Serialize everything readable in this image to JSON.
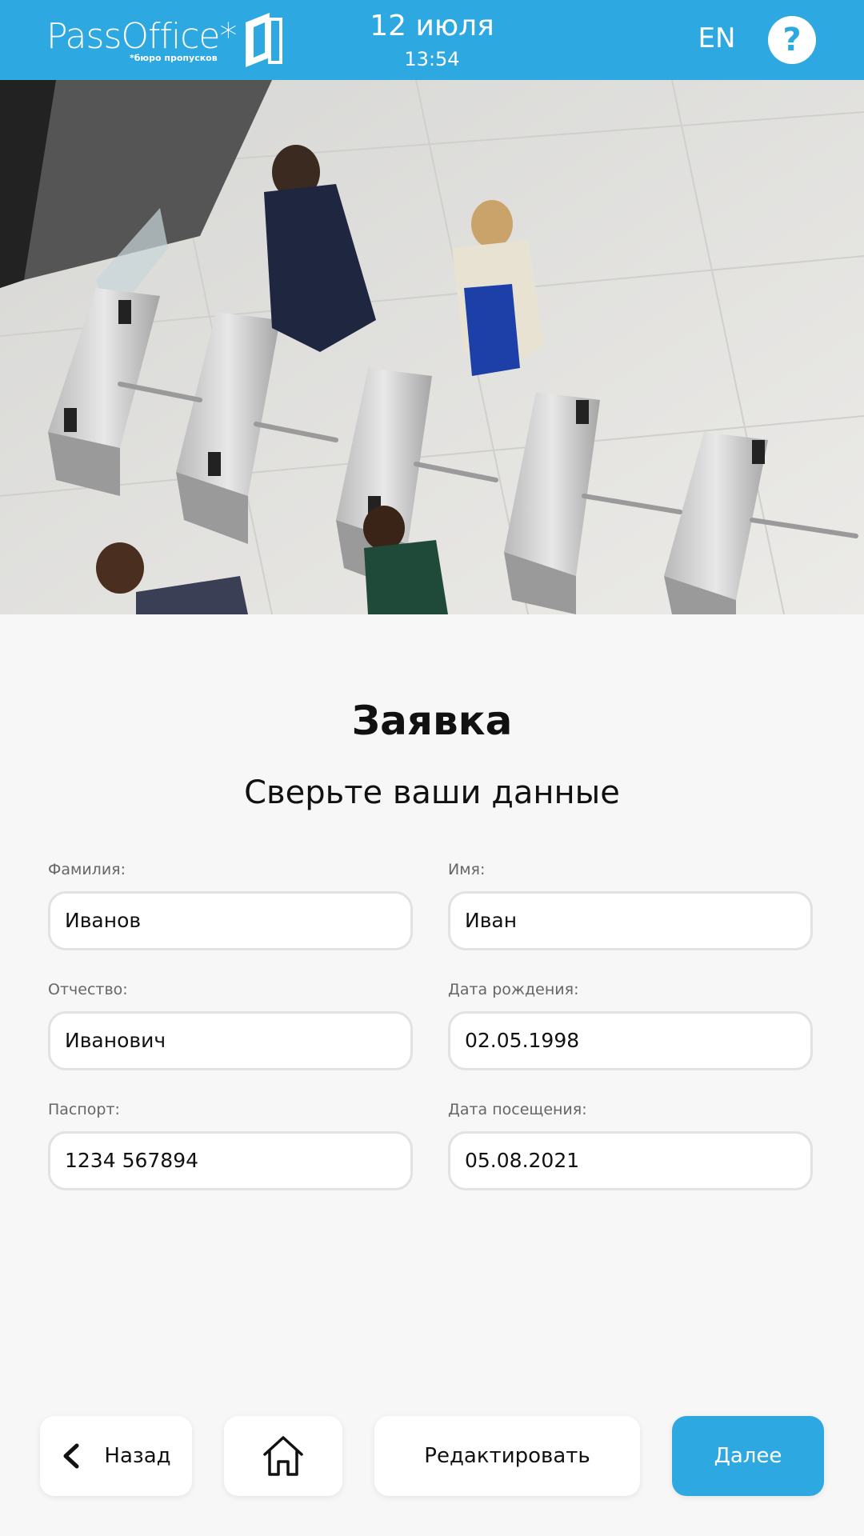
{
  "header": {
    "logo_text": "PassOffice*",
    "logo_sub": "*бюро пропусков",
    "date": "12 июля",
    "time": "13:54",
    "lang": "EN",
    "help": "?"
  },
  "main": {
    "title": "Заявка",
    "subtitle": "Сверьте ваши данные",
    "fields": {
      "lastname": {
        "label": "Фамилия:",
        "value": "Иванов"
      },
      "firstname": {
        "label": "Имя:",
        "value": "Иван"
      },
      "patronymic": {
        "label": "Отчество:",
        "value": "Иванович"
      },
      "birthdate": {
        "label": "Дата рождения:",
        "value": "02.05.1998"
      },
      "passport": {
        "label": "Паспорт:",
        "value": "1234 567894"
      },
      "visitdate": {
        "label": "Дата посещения:",
        "value": "05.08.2021"
      }
    }
  },
  "footer": {
    "back": "Назад",
    "edit": "Редактировать",
    "next": "Далее"
  },
  "colors": {
    "accent": "#2ea8e0",
    "background": "#f7f7f7"
  },
  "icons": [
    "logo-mark-icon",
    "help-icon",
    "chevron-left-icon",
    "home-icon"
  ]
}
